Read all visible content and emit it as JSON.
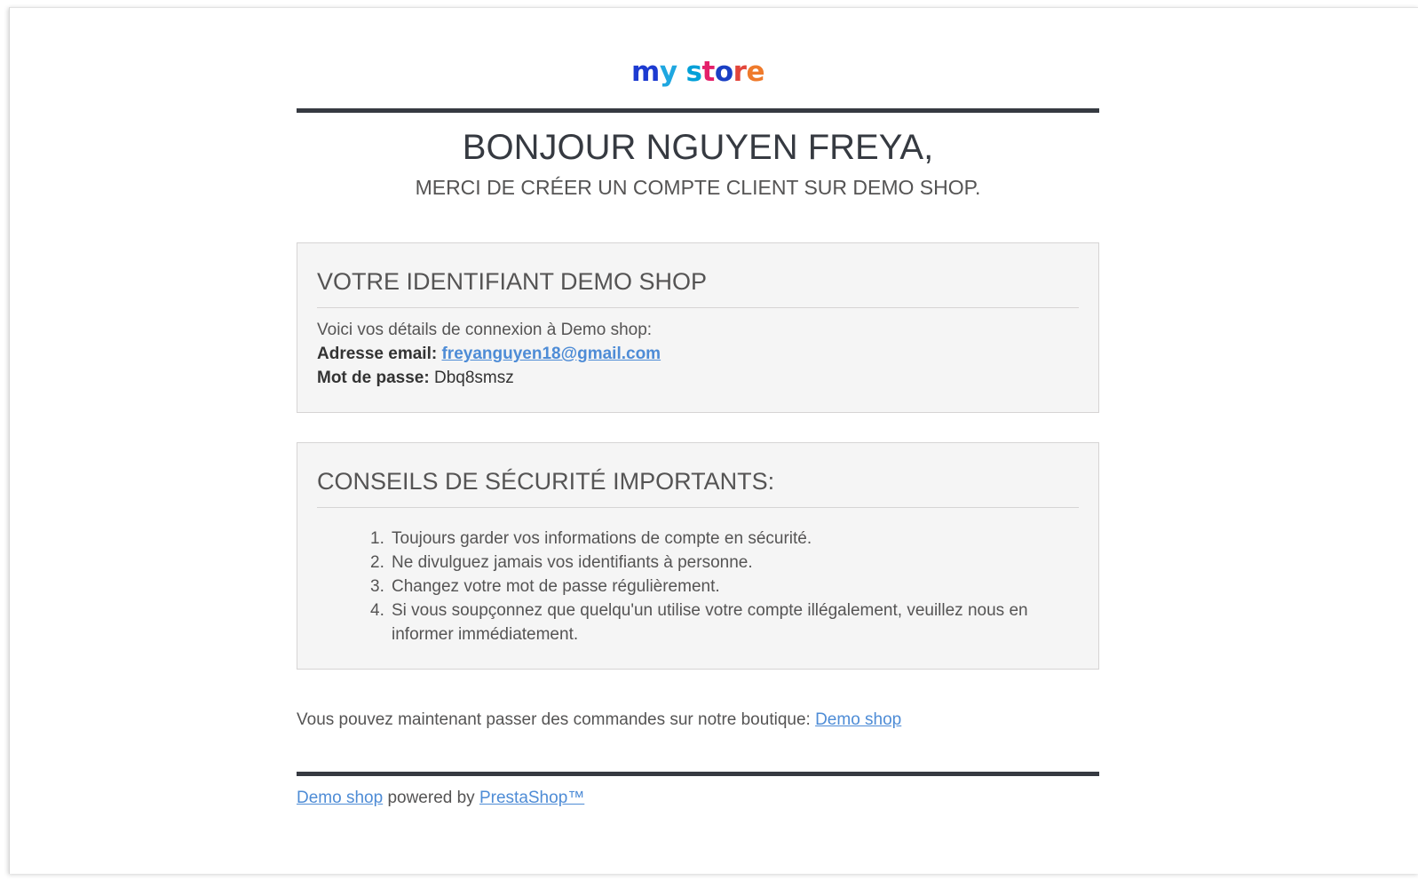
{
  "logo": {
    "text_part1": "my",
    "text_part2": "store",
    "colors": [
      "#1d3bd1",
      "#1fa7e0",
      "#00a0d8",
      "#e4206a",
      "#1a3fc4",
      "#e2453a",
      "#ef7a2b"
    ]
  },
  "header": {
    "greeting": "BONJOUR NGUYEN FREYA,",
    "thanks": "MERCI DE CRÉER UN COMPTE CLIENT SUR DEMO SHOP."
  },
  "login_box": {
    "title": "VOTRE IDENTIFIANT DEMO SHOP",
    "intro": "Voici vos détails de connexion à Demo shop:",
    "email_label": "Adresse email:",
    "email_value": "freyanguyen18@gmail.com",
    "password_label": "Mot de passe:",
    "password_value": "Dbq8smsz"
  },
  "tips_box": {
    "title": "CONSEILS DE SÉCURITÉ IMPORTANTS:",
    "items": [
      {
        "num": "1.",
        "text": "Toujours garder vos informations de compte en sécurité."
      },
      {
        "num": "2.",
        "text": "Ne divulguez jamais vos identifiants à personne."
      },
      {
        "num": "3.",
        "text": "Changez votre mot de passe régulièrement."
      },
      {
        "num": "4.",
        "text": "Si vous soupçonnez que quelqu'un utilise votre compte illégalement, veuillez nous en informer immédiatement."
      }
    ]
  },
  "order": {
    "text": "Vous pouvez maintenant passer des commandes sur notre boutique: ",
    "link": "Demo shop"
  },
  "footer": {
    "shop_link": "Demo shop",
    "powered_by": " powered by ",
    "prestashop_link": "PrestaShop™"
  },
  "colors": {
    "link": "#4e8cd6",
    "rule": "#363a41",
    "box_bg": "#f5f5f5",
    "text": "#555454"
  }
}
